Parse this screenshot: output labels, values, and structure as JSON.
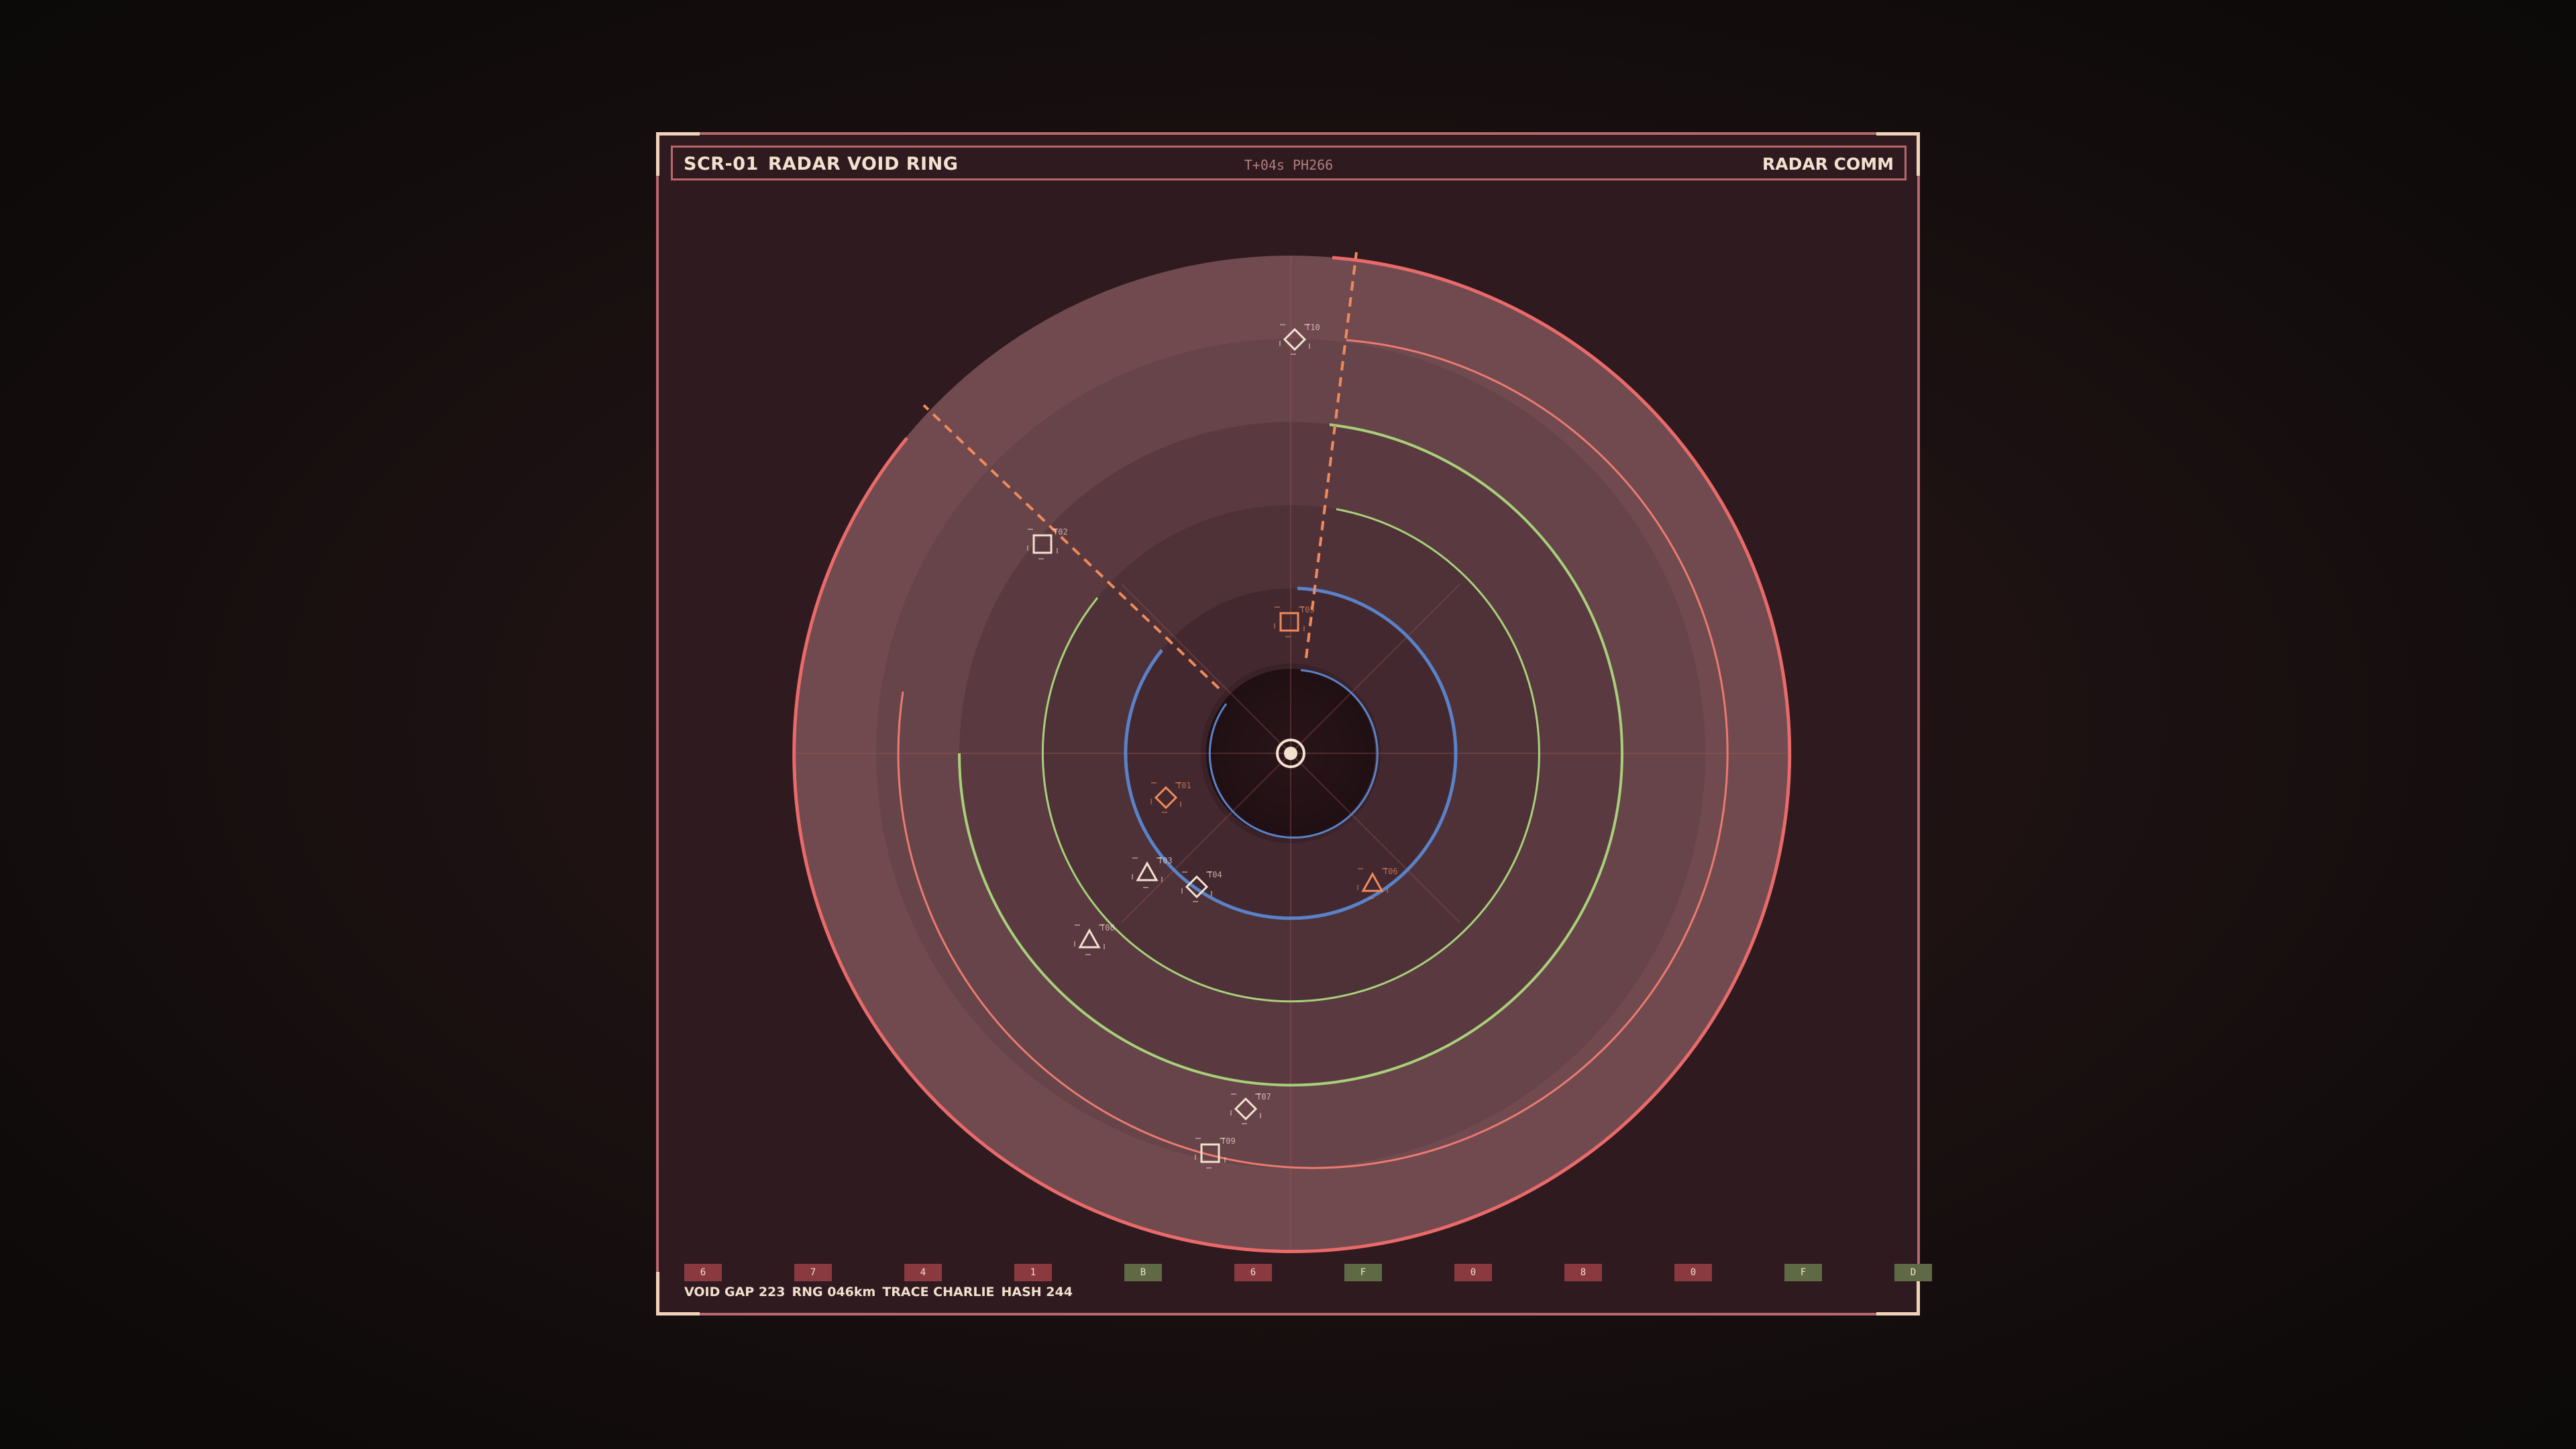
{
  "header": {
    "code": "SCR-01",
    "title": "RADAR VOID RING",
    "telemetry": "T+04s PH266",
    "mode": "RADAR COMM"
  },
  "colors": {
    "frame": "#b8686c",
    "outer_ring": "#ea6a6a",
    "mid_ring": "#ec7a70",
    "green_ring": "#a8d07a",
    "blue_ring": "#5a82c8",
    "sweep": "#f08a5a",
    "accent": "#f3e1cf"
  },
  "contacts": [
    {
      "shape": "diamond",
      "label": "T10",
      "color": "#f3e1cf"
    },
    {
      "shape": "square",
      "label": "T02",
      "color": "#f3e1cf"
    },
    {
      "shape": "square",
      "label": "T05",
      "color": "#f08a5a"
    },
    {
      "shape": "diamond",
      "label": "T01",
      "color": "#f08a5a"
    },
    {
      "shape": "triangle",
      "label": "T03",
      "color": "#f3e1cf"
    },
    {
      "shape": "diamond",
      "label": "T04",
      "color": "#f3e1cf"
    },
    {
      "shape": "triangle",
      "label": "T06",
      "color": "#f08a5a"
    },
    {
      "shape": "triangle",
      "label": "T08",
      "color": "#f3e1cf"
    },
    {
      "shape": "diamond",
      "label": "T07",
      "color": "#f3e1cf"
    },
    {
      "shape": "square",
      "label": "T09",
      "color": "#f3e1cf"
    }
  ],
  "legend_chips": [
    {
      "label": "6",
      "color": "#8a3a3f"
    },
    {
      "label": "7",
      "color": "#8a3a3f"
    },
    {
      "label": "4",
      "color": "#8a3a3f"
    },
    {
      "label": "1",
      "color": "#8a3a3f"
    },
    {
      "label": "B",
      "color": "#5f6a45"
    },
    {
      "label": "6",
      "color": "#8a3a3f"
    },
    {
      "label": "F",
      "color": "#5f6a45"
    },
    {
      "label": "0",
      "color": "#8a3a3f"
    },
    {
      "label": "8",
      "color": "#8a3a3f"
    },
    {
      "label": "0",
      "color": "#8a3a3f"
    },
    {
      "label": "F",
      "color": "#5f6a45"
    },
    {
      "label": "D",
      "color": "#5f6a45"
    }
  ],
  "status": {
    "gap": "VOID GAP 223",
    "range": "RNG 046km",
    "trace": "TRACE CHARLIE",
    "hash": "HASH 244"
  }
}
